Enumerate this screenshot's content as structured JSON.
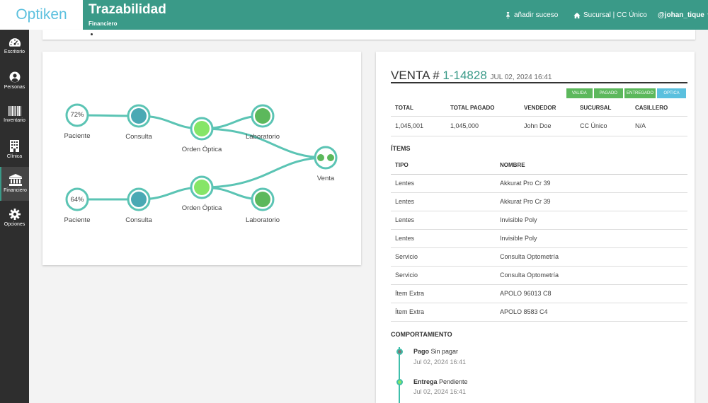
{
  "app": {
    "logo": "Optiken",
    "title": "Trazabilidad",
    "subtitle": "Financiero"
  },
  "header": {
    "add_event": "añadir suceso",
    "branch": "Sucursal | CC Único",
    "user": "@johan_tique"
  },
  "sidebar": {
    "items": [
      {
        "label": "Escritorio",
        "icon": "dashboard-icon"
      },
      {
        "label": "Personas",
        "icon": "person-icon"
      },
      {
        "label": "Inventario",
        "icon": "barcode-icon"
      },
      {
        "label": "Clínica",
        "icon": "building-icon"
      },
      {
        "label": "Financiero",
        "icon": "bank-icon"
      },
      {
        "label": "Opciones",
        "icon": "gear-icon"
      }
    ]
  },
  "graph": {
    "top": {
      "percent": "72%",
      "patient": "Paciente",
      "consult": "Consulta",
      "order": "Orden Óptica",
      "lab": "Laboratorio"
    },
    "bottom": {
      "percent": "64%",
      "patient": "Paciente",
      "consult": "Consulta",
      "order": "Orden Óptica",
      "lab": "Laboratorio"
    },
    "sale": "Venta",
    "colors": {
      "edge": "#5bc4b4",
      "ring": "#5bc4b4",
      "consult_fill": "#4aa9b4",
      "order_fill": "#86e567",
      "lab_fill": "#5cb85c"
    }
  },
  "sale": {
    "prefix": "VENTA #",
    "number": "1-14828",
    "date": "JUL 02, 2024 16:41",
    "badges": [
      {
        "label": "VALIDA",
        "color": "#5cb85c"
      },
      {
        "label": "PAGADO",
        "color": "#5cb85c"
      },
      {
        "label": "ENTREGADO",
        "color": "#5cb85c"
      },
      {
        "label": "OPTICA",
        "color": "#5bc0de"
      }
    ],
    "summary": {
      "headers": [
        "TOTAL",
        "TOTAL PAGADO",
        "VENDEDOR",
        "SUCURSAL",
        "CASILLERO"
      ],
      "row": [
        "1,045,001",
        "1,045,000",
        "John Doe",
        "CC Único",
        "N/A"
      ]
    },
    "items_title": "ÍTEMS",
    "items": {
      "headers": [
        "TIPO",
        "NOMBRE"
      ],
      "rows": [
        [
          "Lentes",
          "Akkurat Pro Cr 39"
        ],
        [
          "Lentes",
          "Akkurat Pro Cr 39"
        ],
        [
          "Lentes",
          "Invisible Poly"
        ],
        [
          "Lentes",
          "Invisible Poly"
        ],
        [
          "Servicio",
          "Consulta Optometría"
        ],
        [
          "Servicio",
          "Consulta Optometría"
        ],
        [
          "Ítem Extra",
          "APOLO 96013 C8"
        ],
        [
          "Ítem Extra",
          "APOLO 8583 C4"
        ]
      ]
    },
    "behavior_title": "COMPORTAMIENTO",
    "timeline": [
      {
        "title": "Pago",
        "status": "Sin pagar",
        "date": "Jul 02, 2024 16:41",
        "dot_color": "#5bc4b4"
      },
      {
        "title": "Entrega",
        "status": "Pendiente",
        "date": "Jul 02, 2024 16:41",
        "dot_color": "#86e567"
      }
    ]
  }
}
